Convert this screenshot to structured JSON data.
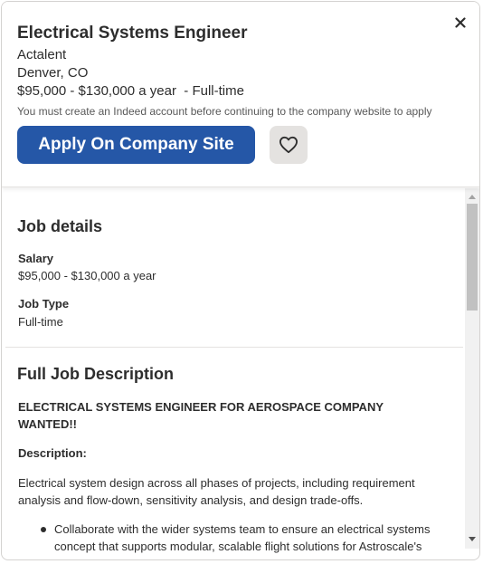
{
  "header": {
    "job_title": "Electrical Systems Engineer",
    "company": "Actalent",
    "location": "Denver, CO",
    "salary_type": "$95,000 - $130,000 a year  - Full-time",
    "notice": "You must create an Indeed account before continuing to the company website to apply",
    "apply_label": "Apply On Company Site",
    "close_icon": "close-icon",
    "save_icon": "heart-icon"
  },
  "job_details": {
    "heading": "Job details",
    "salary_label": "Salary",
    "salary_value": "$95,000 - $130,000 a year",
    "job_type_label": "Job Type",
    "job_type_value": "Full-time"
  },
  "description": {
    "heading": "Full Job Description",
    "tagline": "ELECTRICAL SYSTEMS ENGINEER FOR AEROSPACE COMPANY WANTED!!",
    "desc_label": "Description:",
    "para1": "Electrical system design across all phases of projects, including requirement analysis and flow-down, sensitivity analysis, and design trade-offs.",
    "bullet1": "Collaborate with the wider systems team to ensure an electrical systems concept that supports modular, scalable flight solutions for Astroscale's"
  },
  "colors": {
    "accent": "#2557a7",
    "text": "#2d2d2d",
    "save_bg": "#e4e2e0"
  }
}
